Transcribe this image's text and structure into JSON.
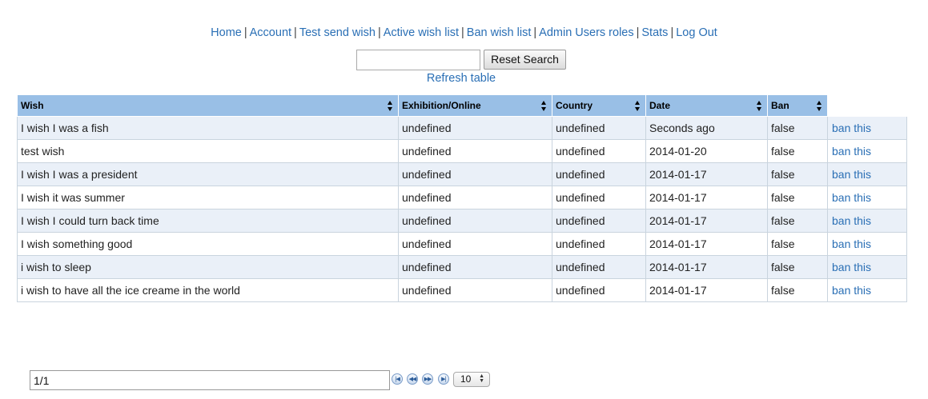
{
  "nav": {
    "items": [
      {
        "label": "Home"
      },
      {
        "label": "Account"
      },
      {
        "label": "Test send wish"
      },
      {
        "label": "Active wish list"
      },
      {
        "label": "Ban wish list"
      },
      {
        "label": "Admin Users roles"
      },
      {
        "label": "Stats"
      },
      {
        "label": "Log Out"
      }
    ],
    "separator": "|"
  },
  "search": {
    "value": "",
    "placeholder": "",
    "reset_label": "Reset Search"
  },
  "refresh_label": "Refresh table",
  "table": {
    "headers": [
      "Wish",
      "Exhibition/Online",
      "Country",
      "Date",
      "Ban"
    ],
    "action_label": "ban this",
    "rows": [
      [
        "I wish I was a fish",
        "undefined",
        "undefined",
        "Seconds ago",
        "false"
      ],
      [
        "test wish",
        "undefined",
        "undefined",
        "2014-01-20",
        "false"
      ],
      [
        "I wish I was a president",
        "undefined",
        "undefined",
        "2014-01-17",
        "false"
      ],
      [
        "I wish it was summer",
        "undefined",
        "undefined",
        "2014-01-17",
        "false"
      ],
      [
        "I wish I could turn back time",
        "undefined",
        "undefined",
        "2014-01-17",
        "false"
      ],
      [
        "I wish something good",
        "undefined",
        "undefined",
        "2014-01-17",
        "false"
      ],
      [
        "i wish to sleep",
        "undefined",
        "undefined",
        "2014-01-17",
        "false"
      ],
      [
        "i wish to have all the ice creame in the world",
        "undefined",
        "undefined",
        "2014-01-17",
        "false"
      ]
    ]
  },
  "pager": {
    "page_display": "1/1",
    "buttons": [
      {
        "name": "first-page-icon",
        "glyph": "|◀"
      },
      {
        "name": "prev-page-icon",
        "glyph": "◀◀"
      },
      {
        "name": "next-page-icon",
        "glyph": "▶▶"
      },
      {
        "name": "last-page-icon",
        "glyph": "▶|"
      }
    ],
    "page_size": "10"
  }
}
